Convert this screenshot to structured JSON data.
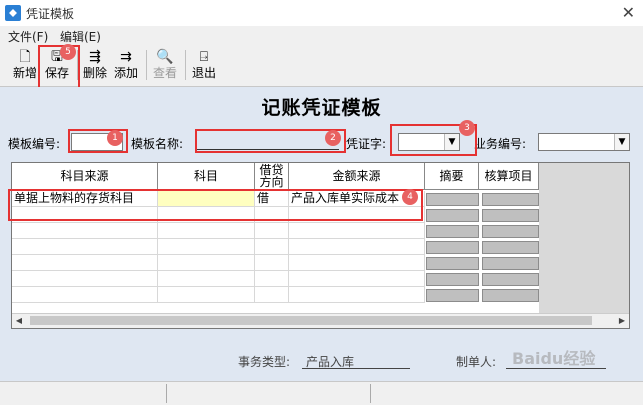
{
  "window": {
    "title": "凭证模板"
  },
  "menu": {
    "file": "文件(F)",
    "edit": "编辑(E)"
  },
  "toolbar": {
    "new_label": "新增",
    "save_label": "保存",
    "delete_label": "删除",
    "add_label": "添加",
    "view_label": "查看",
    "exit_label": "退出"
  },
  "form": {
    "heading": "记账凭证模板",
    "template_no_label": "模板编号:",
    "template_no_value": "",
    "template_name_label": "模板名称:",
    "template_name_value": "",
    "voucher_word_label": "凭证字:",
    "voucher_word_value": "",
    "business_no_label": "业务编号:",
    "business_no_value": ""
  },
  "grid": {
    "headers": {
      "subject_source": "科目来源",
      "subject": "科目",
      "debit_credit": "借贷方向",
      "amount_source": "金额来源",
      "summary": "摘要",
      "accounting_item": "核算项目"
    },
    "rows": [
      {
        "subject_source": "单据上物料的存货科目",
        "subject": "",
        "direction": "借",
        "amount_source": "产品入库单实际成本"
      }
    ]
  },
  "annotations": {
    "badge1": "1",
    "badge2": "2",
    "badge3": "3",
    "badge4": "4",
    "badge5": "5",
    "highlight_color": "#e53232"
  },
  "footer": {
    "business_type_label": "事务类型:",
    "business_type_value": "产品入库",
    "maker_label": "制单人:",
    "maker_value": "Baidu经验"
  },
  "icons": [
    "app-icon",
    "close-icon",
    "new-icon",
    "save-icon",
    "delete-icon",
    "add-icon",
    "view-icon",
    "exit-icon",
    "dropdown-arrow-icon",
    "scroll-left-icon",
    "scroll-right-icon"
  ]
}
